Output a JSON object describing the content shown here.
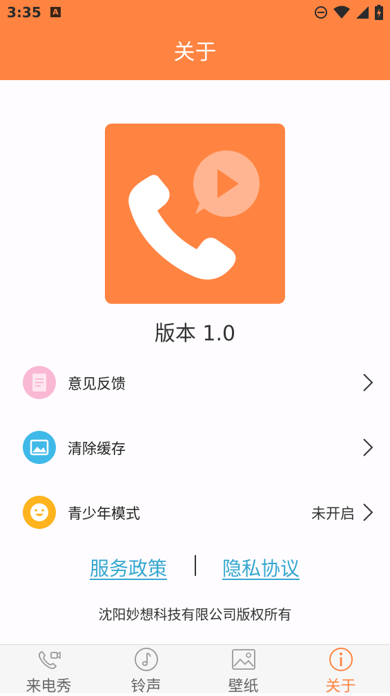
{
  "status_bar": {
    "time": "3:35",
    "notification_glyph": "A",
    "icons": [
      "do-not-disturb-icon",
      "wifi-icon",
      "signal-icon",
      "battery-charging-icon"
    ]
  },
  "app_bar": {
    "title": "关于"
  },
  "app_logo": {
    "icon": "phone-video-logo-icon",
    "color": "#ff8442"
  },
  "version_label": "版本 1.0",
  "menu": [
    {
      "label": "意见反馈",
      "icon": "feedback-icon",
      "color": "#f9b8d4",
      "value": ""
    },
    {
      "label": "清除缓存",
      "icon": "clear-cache-icon",
      "color": "#3fb9e8",
      "value": ""
    },
    {
      "label": "青少年模式",
      "icon": "teen-mode-icon",
      "color": "#ffb31e",
      "value": "未开启"
    }
  ],
  "links": {
    "service_policy": "服务政策",
    "privacy_policy": "隐私协议"
  },
  "copyright": "沈阳妙想科技有限公司版权所有",
  "tab_bar": {
    "tabs": [
      {
        "label": "来电秀",
        "icon": "phone-video-icon",
        "active": false
      },
      {
        "label": "铃声",
        "icon": "music-note-icon",
        "active": false
      },
      {
        "label": "壁纸",
        "icon": "image-icon",
        "active": false
      },
      {
        "label": "关于",
        "icon": "info-icon",
        "active": true
      }
    ]
  },
  "colors": {
    "accent": "#ff8442",
    "link": "#35a7cf",
    "background": "#fefcff"
  }
}
